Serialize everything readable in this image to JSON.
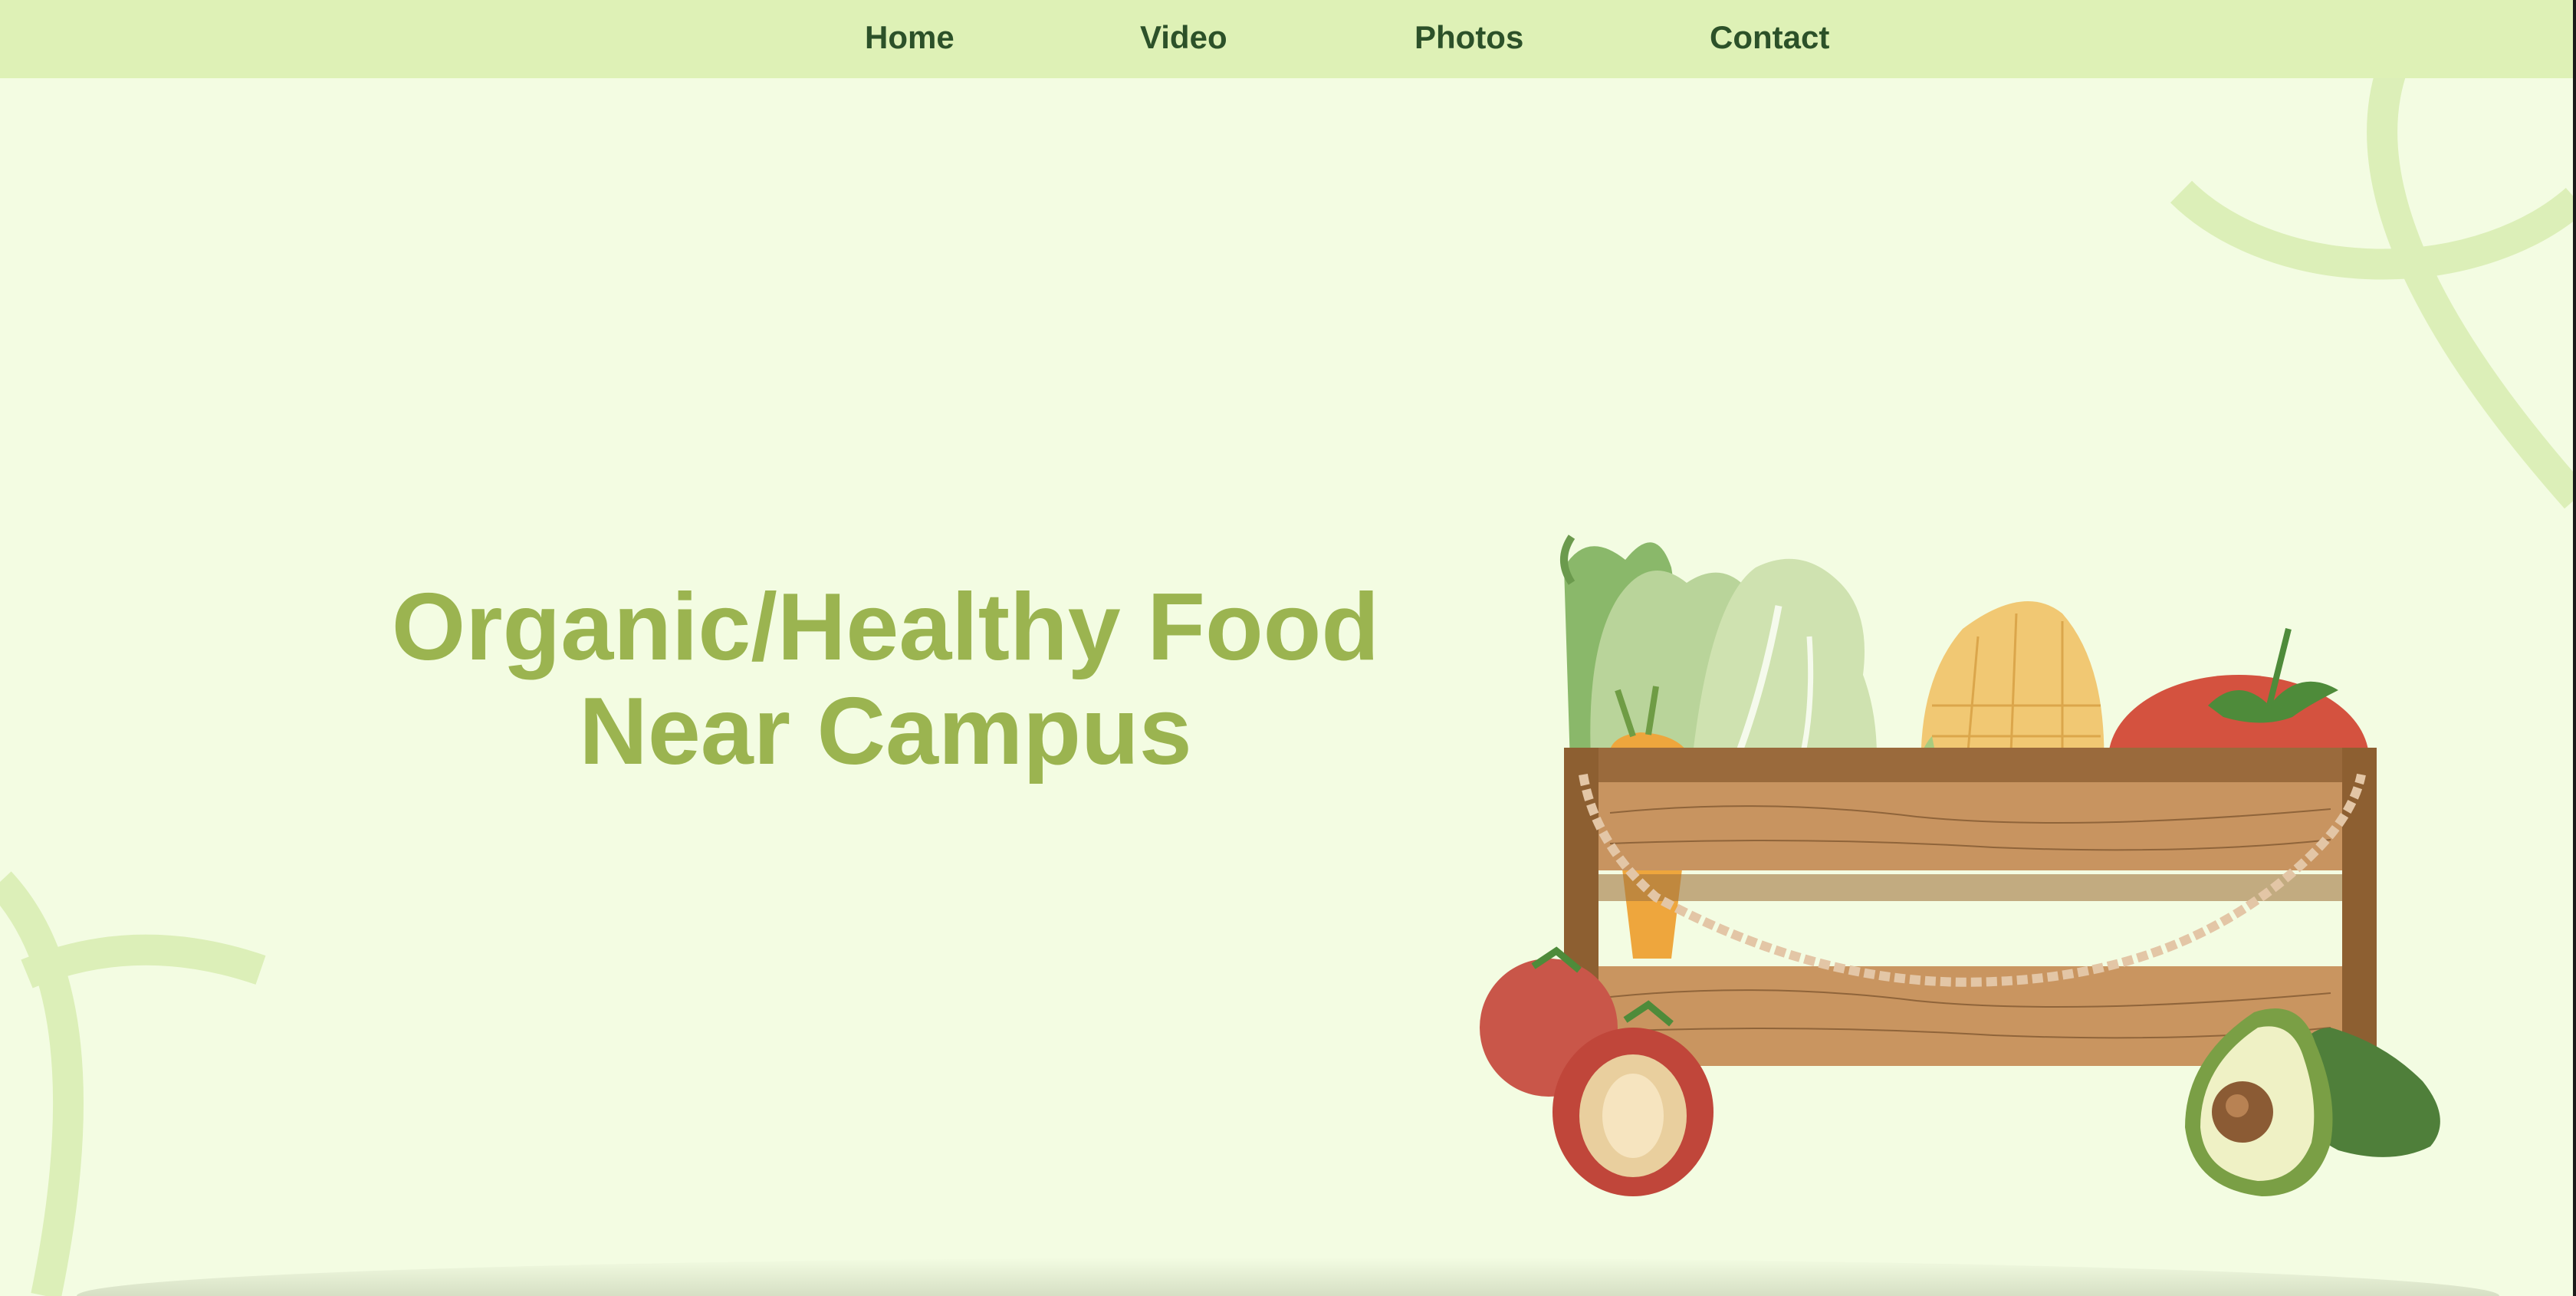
{
  "nav": {
    "items": [
      {
        "label": "Home"
      },
      {
        "label": "Video"
      },
      {
        "label": "Photos"
      },
      {
        "label": "Contact"
      }
    ]
  },
  "hero": {
    "headline_line1": "Organic/Healthy Food",
    "headline_line2": "Near Campus",
    "illustration": "vegetable-crate-illustration"
  },
  "colors": {
    "background": "#f3fce2",
    "navbar": "#def1b6",
    "nav_text": "#2c5129",
    "headline": "#9bb450",
    "decorative_arcs": "#dcefb8"
  }
}
